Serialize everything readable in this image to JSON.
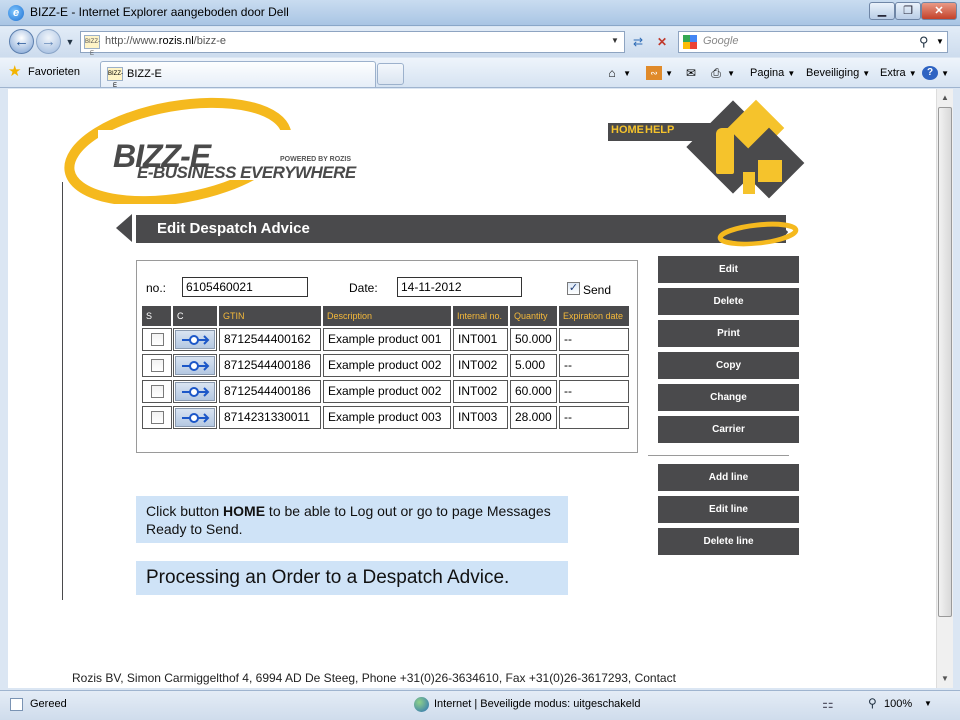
{
  "window": {
    "title": "BIZZ-E - Internet Explorer aangeboden door Dell",
    "min_glyph": "▁",
    "max_glyph": "❐",
    "close_glyph": "✕"
  },
  "address": {
    "url_prefix": "http://www.",
    "url_domain": "rozis.nl",
    "url_path": "/bizz-e",
    "favicon_text": "BIZZ-E",
    "search_placeholder": "Google"
  },
  "favorites_bar": {
    "favorites_label": "Favorieten",
    "tab_label": "BIZZ-E",
    "commands": {
      "page": "Pagina",
      "security": "Beveiliging",
      "extra": "Extra"
    }
  },
  "logo": {
    "brand": "BIZZ-E",
    "tagline": "E-BUSINESS EVERYWHERE",
    "powered_by": "POWERED BY ROZIS"
  },
  "nav": {
    "home": "HOME",
    "help": "HELP"
  },
  "page": {
    "title": "Edit Despatch Advice"
  },
  "form": {
    "no_label": "no.:",
    "no_value": "6105460021",
    "date_label": "Date:",
    "date_value": "14-11-2012",
    "send_label": "Send",
    "send_checked": true
  },
  "table": {
    "headers": [
      "S",
      "C",
      "GTIN",
      "Description",
      "Internal no.",
      "Quantity",
      "Expiration date"
    ],
    "rows": [
      {
        "gtin": "8712544400162",
        "description": "Example product 001",
        "internal": "INT001",
        "quantity": "50.000",
        "expiration": "--"
      },
      {
        "gtin": "8712544400186",
        "description": "Example product 002",
        "internal": "INT002",
        "quantity": "5.000",
        "expiration": "--"
      },
      {
        "gtin": "8712544400186",
        "description": "Example product 002",
        "internal": "INT002",
        "quantity": "60.000",
        "expiration": "--"
      },
      {
        "gtin": "8714231330011",
        "description": "Example product 003",
        "internal": "INT003",
        "quantity": "28.000",
        "expiration": "--"
      }
    ]
  },
  "actions": {
    "edit": "Edit",
    "delete": "Delete",
    "print": "Print",
    "copy": "Copy",
    "change": "Change",
    "carrier": "Carrier",
    "add_line": "Add line",
    "edit_line": "Edit line",
    "delete_line": "Delete line"
  },
  "notes": {
    "note1_pre": "Click button ",
    "note1_bold": "HOME",
    "note1_post": " to be able to Log out or go to page Messages Ready to Send.",
    "note2": "Processing an Order to a Despatch Advice."
  },
  "footer": {
    "text": "Rozis BV, Simon Carmiggelthof 4, 6994 AD De Steeg, Phone +31(0)26-3634610, Fax +31(0)26-3617293, Contact"
  },
  "statusbar": {
    "status": "Gereed",
    "zone": "Internet | Beveiligde modus: uitgeschakeld",
    "zoom": "100%"
  },
  "colors": {
    "dark_gray": "#4a4a4c",
    "accent_yellow": "#f5c32c",
    "header_text": "#f5b93a",
    "note_bg": "#cfe3f7"
  }
}
